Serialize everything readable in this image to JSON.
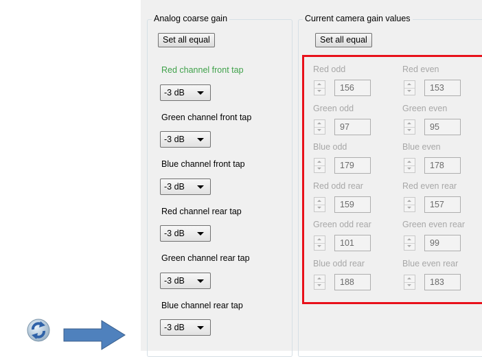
{
  "analog_group": {
    "title": "Analog coarse gain",
    "set_all_label": "Set all equal",
    "channels": [
      {
        "label": "Red channel front tap",
        "value": "-3 dB"
      },
      {
        "label": "Green channel front tap",
        "value": "-3 dB"
      },
      {
        "label": "Blue channel front tap",
        "value": "-3 dB"
      },
      {
        "label": "Red channel rear tap",
        "value": "-3 dB"
      },
      {
        "label": "Green channel rear tap",
        "value": "-3 dB"
      },
      {
        "label": "Blue channel rear tap",
        "value": "-3 dB"
      }
    ]
  },
  "camera_group": {
    "title": "Current camera gain values",
    "set_all_label": "Set all equal",
    "gains": [
      {
        "label": "Red odd",
        "value": "156"
      },
      {
        "label": "Red even",
        "value": "153"
      },
      {
        "label": "Green odd",
        "value": "97"
      },
      {
        "label": "Green even",
        "value": "95"
      },
      {
        "label": "Blue odd",
        "value": "179"
      },
      {
        "label": "Blue even",
        "value": "178"
      },
      {
        "label": "Red odd rear",
        "value": "159"
      },
      {
        "label": "Red even rear",
        "value": "157"
      },
      {
        "label": "Green odd rear",
        "value": "101"
      },
      {
        "label": "Green even rear",
        "value": "99"
      },
      {
        "label": "Blue odd rear",
        "value": "188"
      },
      {
        "label": "Blue even rear",
        "value": "183"
      }
    ]
  },
  "colors": {
    "active_label": "#3fa14a",
    "highlight_border": "#e8101a",
    "arrow_fill": "#4f81bd"
  },
  "icons": {
    "refresh": "refresh-icon",
    "arrow": "right-arrow-icon"
  }
}
